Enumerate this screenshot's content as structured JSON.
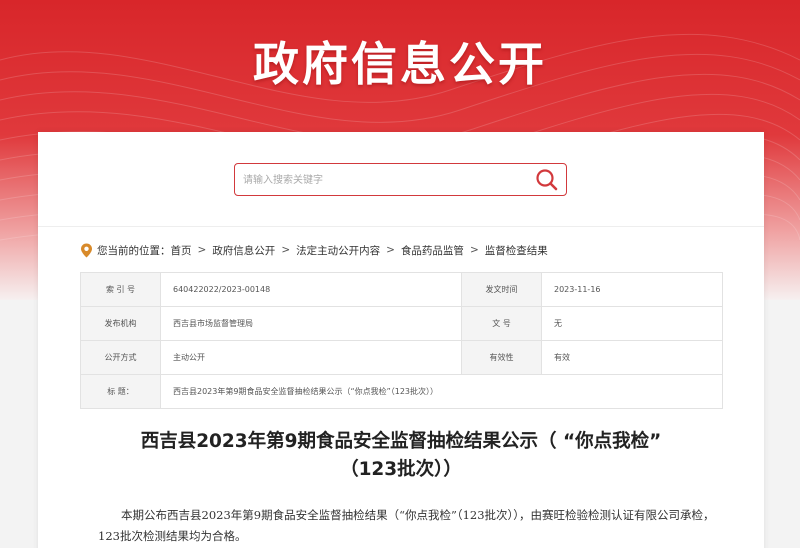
{
  "banner": {
    "title": "政府信息公开"
  },
  "search": {
    "placeholder": "请输入搜索关键字"
  },
  "breadcrumb": {
    "prefix": "您当前的位置：",
    "items": [
      "首页",
      "政府信息公开",
      "法定主动公开内容",
      "食品药品监管",
      "监督检查结果"
    ],
    "separator": ">"
  },
  "meta": {
    "rows": [
      {
        "label1": "索 引 号",
        "value1": "640422022/2023-00148",
        "label2": "发文时间",
        "value2": "2023-11-16"
      },
      {
        "label1": "发布机构",
        "value1": "西吉县市场监督管理局",
        "label2": "文 号",
        "value2": "无"
      },
      {
        "label1": "公开方式",
        "value1": "主动公开",
        "label2": "有效性",
        "value2": "有效"
      }
    ],
    "title_label": "标 题：",
    "title_value": "西吉县2023年第9期食品安全监督抽检结果公示（“你点我检”（123批次））"
  },
  "article": {
    "title_line1": "西吉县2023年第9期食品安全监督抽检结果公示（ “你点我检”",
    "title_line2": "（123批次））",
    "body": "本期公布西吉县2023年第9期食品安全监督抽检结果（“你点我检”（123批次）），由赛旺检验检测认证有限公司承检，123批次检测结果均为合格。"
  },
  "colors": {
    "accent": "#d2393c",
    "banner": "#d8262a"
  }
}
